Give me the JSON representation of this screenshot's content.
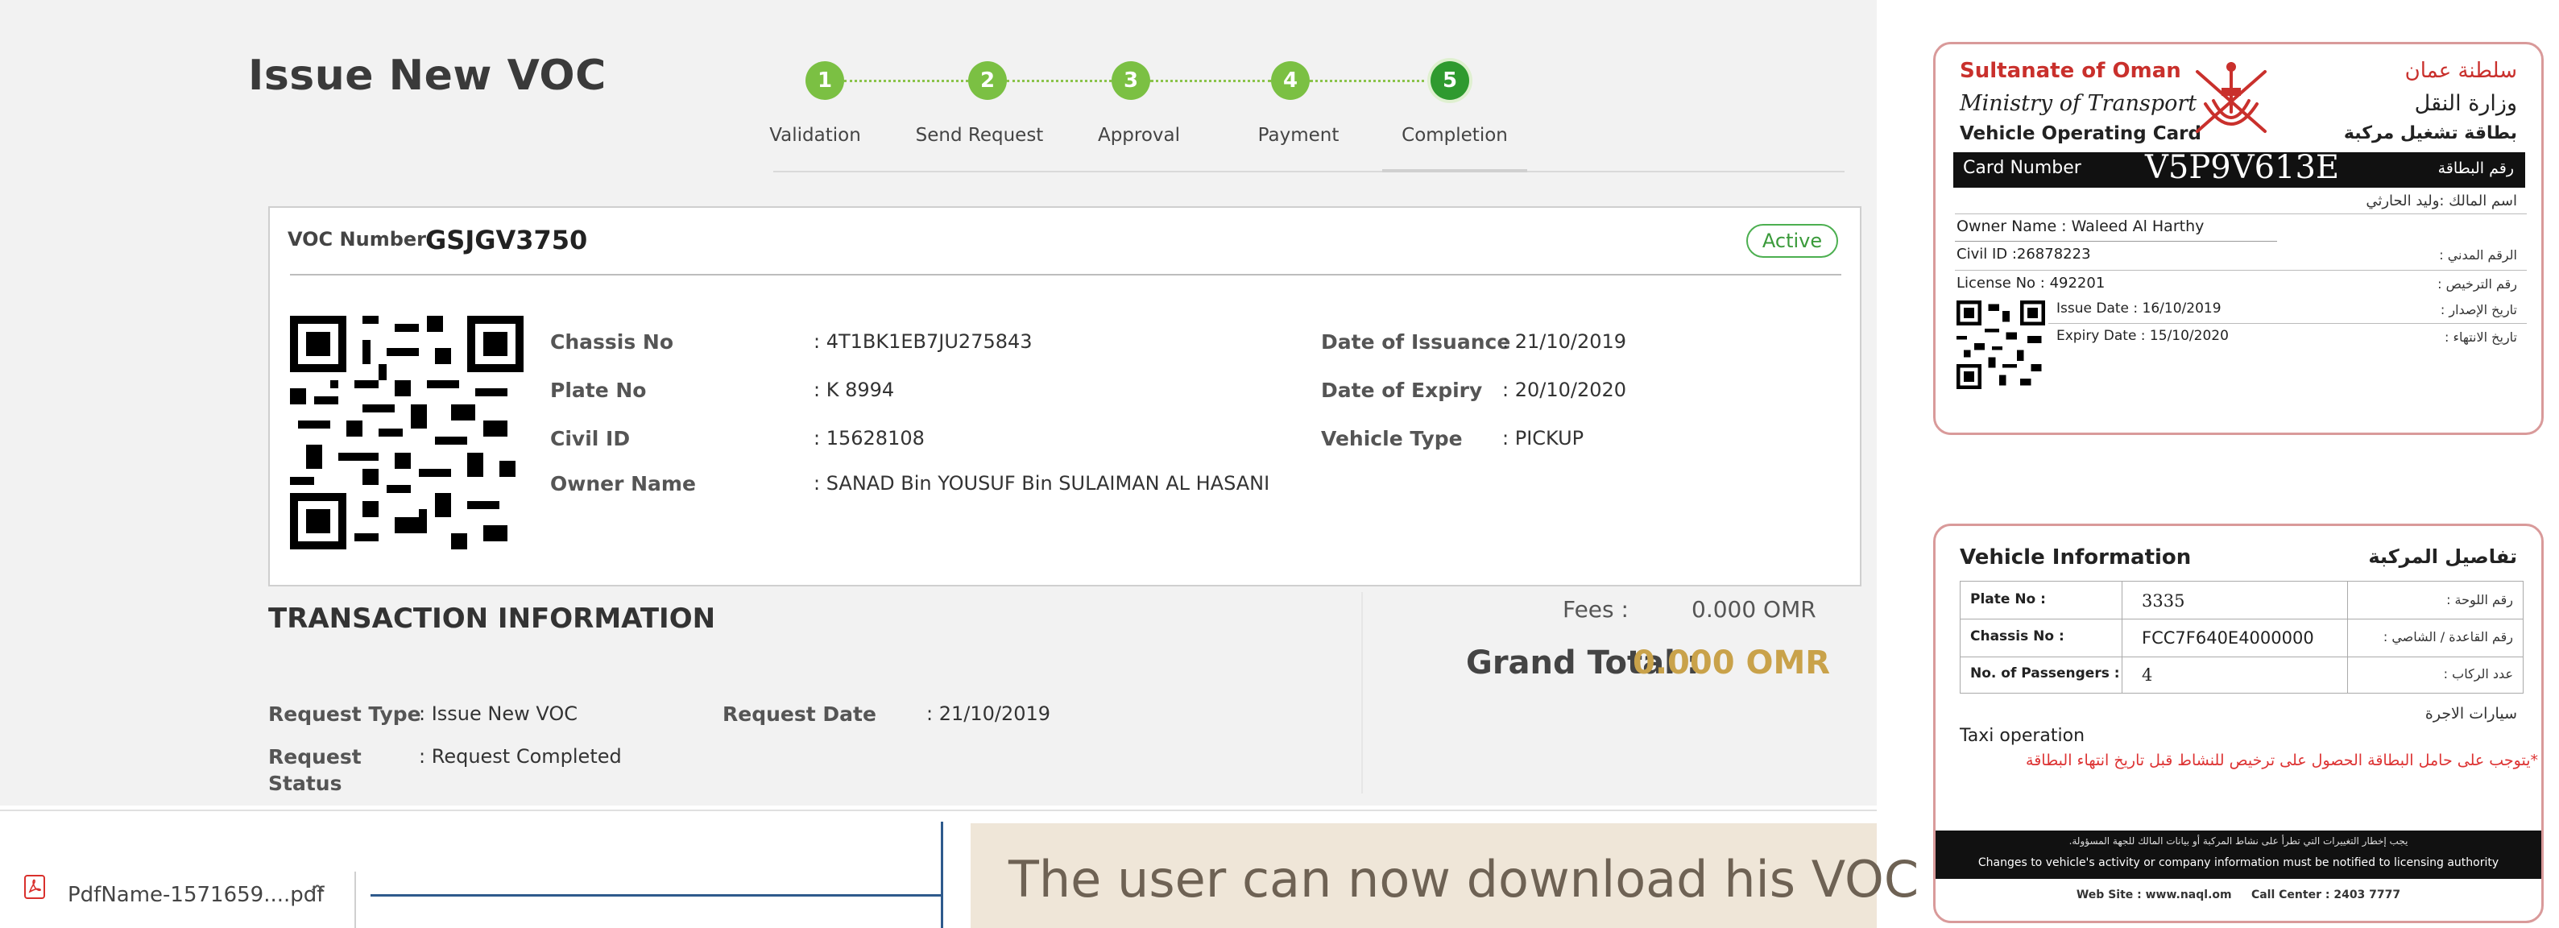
{
  "page": {
    "title": "Issue New VOC"
  },
  "steps": [
    {
      "num": "1",
      "label": "Validation"
    },
    {
      "num": "2",
      "label": "Send Request"
    },
    {
      "num": "3",
      "label": "Approval"
    },
    {
      "num": "4",
      "label": "Payment"
    },
    {
      "num": "5",
      "label": "Completion"
    }
  ],
  "voc": {
    "number_label": "VOC Number",
    "number": "GSJGV3750",
    "status": "Active",
    "fields_left": [
      {
        "label": "Chassis No",
        "value": ": 4T1BK1EB7JU275843"
      },
      {
        "label": "Plate No",
        "value": ": K 8994"
      },
      {
        "label": "Civil ID",
        "value": ": 15628108"
      },
      {
        "label": "Owner Name",
        "value": ": SANAD Bin YOUSUF Bin SULAIMAN AL HASANI"
      }
    ],
    "fields_right": [
      {
        "label": "Date of Issuance",
        "value": ": 21/10/2019"
      },
      {
        "label": "Date of Expiry",
        "value": ": 20/10/2020"
      },
      {
        "label": "Vehicle Type",
        "value": ": PICKUP"
      }
    ]
  },
  "transaction": {
    "title": "TRANSACTION INFORMATION",
    "request_type_label": "Request Type",
    "request_type_value": ": Issue New VOC",
    "request_date_label": "Request Date",
    "request_date_value": ": 21/10/2019",
    "request_status_label_1": "Request",
    "request_status_label_2": "Status",
    "request_status_value": ": Request Completed",
    "fees_label": "Fees :",
    "fees_value": "0.000 OMR",
    "grand_total_label": "Grand Total :",
    "grand_total_value": "0.000 OMR"
  },
  "download": {
    "filename": "PdfName-1571659....pdf",
    "chevron": "^"
  },
  "callout": {
    "text": "The user can now download his VOC"
  },
  "card1": {
    "title_en_1": "Sultanate of Oman",
    "title_en_2": "Ministry of Transport",
    "title_en_3": "Vehicle Operating Card",
    "title_ar_1": "سلطنة عمان",
    "title_ar_2": "وزارة النقل",
    "title_ar_3": "بطاقة تشغيل مركبة",
    "card_number_label": "Card Number",
    "card_number": "V5P9V613E",
    "card_number_label_ar": "رقم البطاقة",
    "owner_ar": "اسم المالك :وليد الحارثي",
    "owner_name": "Owner Name : Waleed Al Harthy",
    "civil_id": "Civil ID :26878223",
    "civil_id_ar": "الرقم المدني :",
    "license_no": "License No : 492201",
    "license_no_ar": "رقم الترخيص :",
    "issue_date": "Issue Date  : 16/10/2019",
    "issue_date_ar": "تاريخ الإصدار :",
    "expiry_date": "Expiry Date : 15/10/2020",
    "expiry_date_ar": "تاريخ الانتهاء :"
  },
  "card2": {
    "title_en": "Vehicle Information",
    "title_ar": "تفاصيل المركبة",
    "rows": [
      {
        "label": "Plate No :",
        "value": "3335",
        "label_ar": "رقم اللوحة :"
      },
      {
        "label": "Chassis No :",
        "value": "FCC7F640E4000000",
        "label_ar": "رقم القاعدة / الشاصي :"
      },
      {
        "label": "No. of Passengers :",
        "value": "4",
        "label_ar": "عدد الركاب :"
      }
    ],
    "category_ar": "سيارات الاجرة",
    "category_en": "Taxi operation",
    "warning_ar": "*يتوجب على حامل البطاقة الحصول على ترخيص للنشاط قبل تاريخ انتهاء البطاقة",
    "footer_ar": "يجب إخطار التغييرات التي تطرأ على نشاط المركبة أو بيانات المالك للجهة المسؤولة.",
    "footer_en": "Changes to vehicle's activity or company information must be notified to licensing authority",
    "website": "Web Site : www.naql.om     Call Center : 2403 7777"
  },
  "colors": {
    "step_green": "#7bc043",
    "active_green": "#2f9a2f",
    "grand_total_gold": "#c9a24a",
    "card_border": "#d99a9a",
    "callout_bg": "#efe6d8",
    "callout_line": "#2e5a8c",
    "warning_red": "#d33"
  }
}
